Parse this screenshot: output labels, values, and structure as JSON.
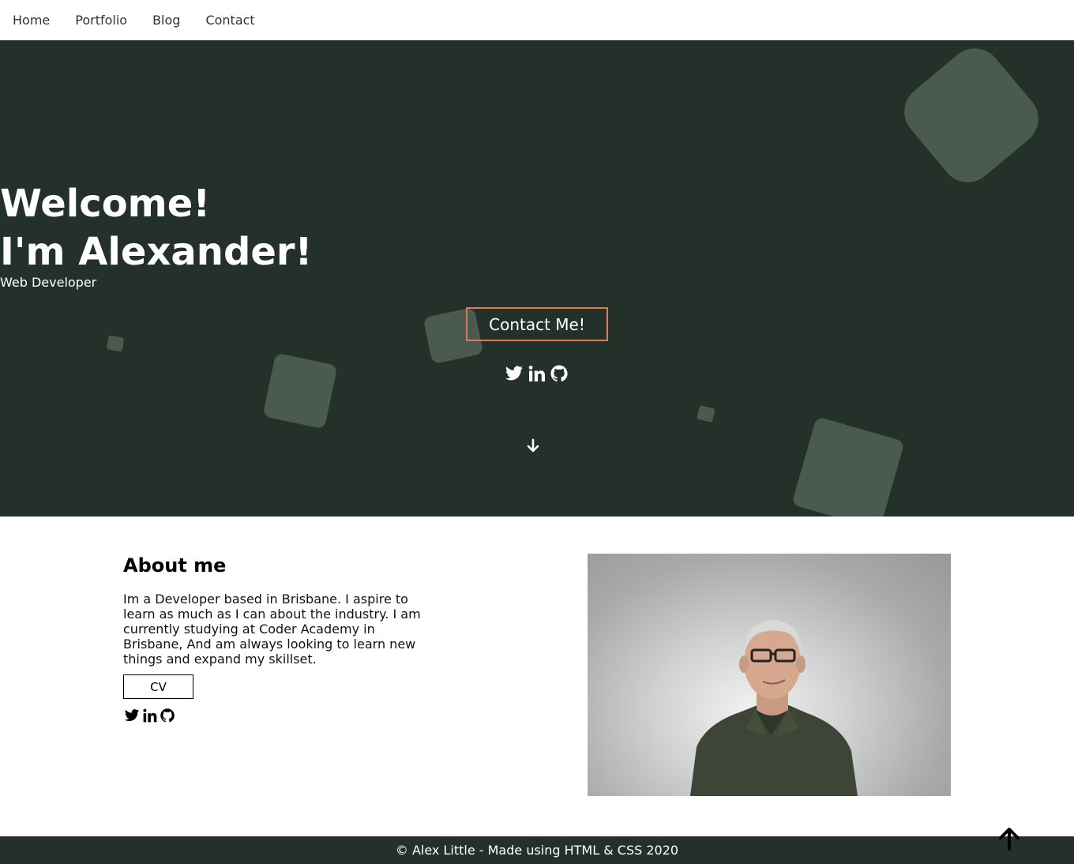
{
  "nav": {
    "items": [
      {
        "label": "Home"
      },
      {
        "label": "Portfolio"
      },
      {
        "label": "Blog"
      },
      {
        "label": "Contact"
      }
    ]
  },
  "hero": {
    "title_line1": "Welcome!",
    "title_line2": "I'm Alexander!",
    "subtitle": "Web Developer",
    "contact_button": "Contact Me!",
    "social_icons": [
      "twitter-icon",
      "linkedin-icon",
      "github-icon"
    ]
  },
  "about": {
    "heading": "About me",
    "body": "Im a Developer based in Brisbane. I aspire to learn as much as I can about the industry. I am currently studying at Coder Academy in Brisbane, And am always looking to learn new things and expand my skillset.",
    "cv_button": "CV",
    "social_icons": [
      "twitter-icon",
      "linkedin-icon",
      "github-icon"
    ]
  },
  "footer": {
    "text": "© Alex Little - Made using HTML & CSS 2020"
  },
  "colors": {
    "hero_bg": "#24312a",
    "shape": "#4a5a4e",
    "accent": "#e07a5f"
  }
}
